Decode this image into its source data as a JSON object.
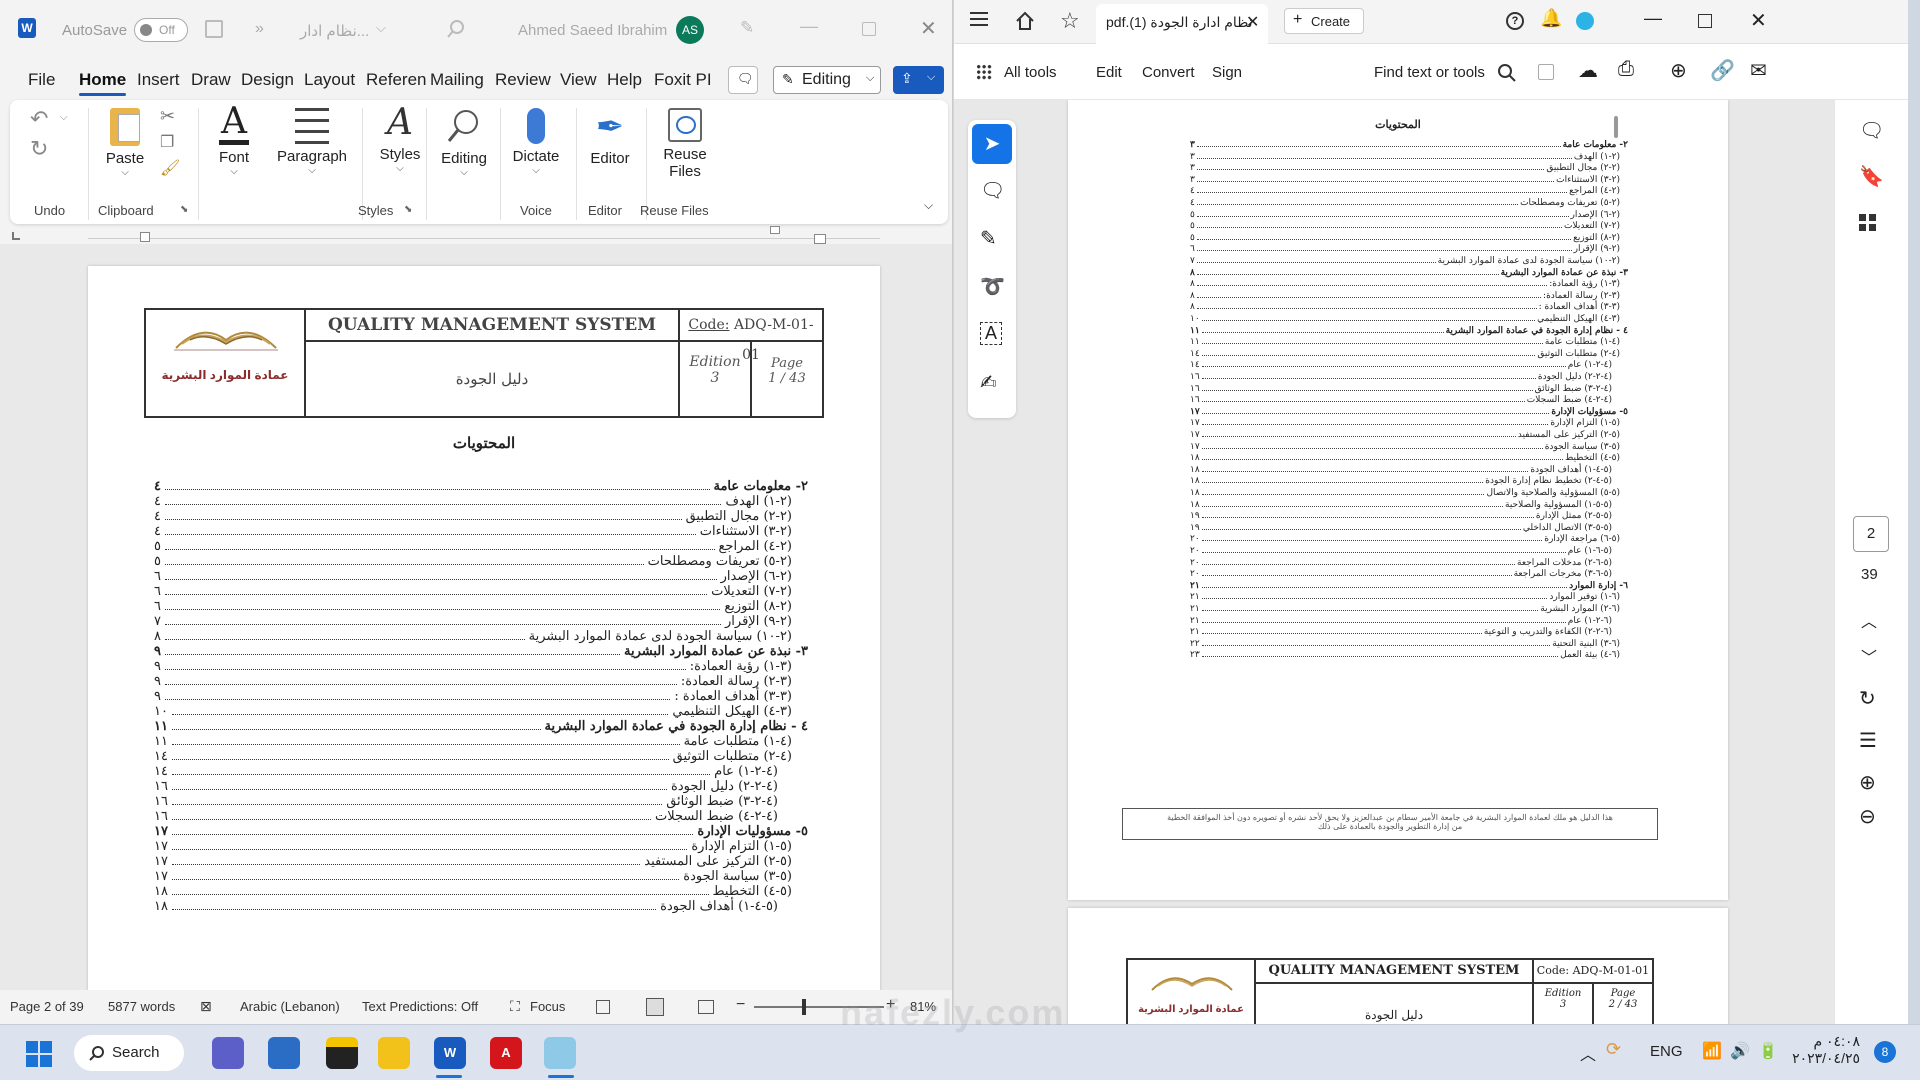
{
  "word": {
    "autosave_label": "AutoSave",
    "autosave_state": "Off",
    "doc_title": "نظام ادار...",
    "user_name": "Ahmed Saeed Ibrahim",
    "user_initials": "AS",
    "menu": [
      "File",
      "Home",
      "Insert",
      "Draw",
      "Design",
      "Layout",
      "Referen",
      "Mailing",
      "Review",
      "View",
      "Help",
      "Foxit PI"
    ],
    "editing_mode": "Editing",
    "ribbon": {
      "undo": "Undo",
      "paste": "Paste",
      "clipboard": "Clipboard",
      "font": "Font",
      "paragraph": "Paragraph",
      "styles": "Styles",
      "styles_group": "Styles",
      "editing": "Editing",
      "dictate": "Dictate",
      "voice": "Voice",
      "editor": "Editor",
      "editor_group": "Editor",
      "reuse_files_1": "Reuse",
      "reuse_files_2": "Files",
      "reuse_files_group": "Reuse Files"
    },
    "header": {
      "org": "عمادة الموارد البشرية",
      "system": "QUALITY MANAGEMENT SYSTEM",
      "code_label": "Code:",
      "code_value": "ADQ-M-01-01",
      "manual": "دليل الجودة",
      "edition_label": "Edition",
      "edition_value": "3",
      "page_label": "Page",
      "page_value": "1 / 43"
    },
    "toc_title": "المحتويات",
    "toc": [
      {
        "t": "٢- معلومات عامة",
        "p": "٤",
        "lvl": 0
      },
      {
        "t": "(٢-١) الهدف",
        "p": "٤",
        "lvl": 1
      },
      {
        "t": "(٢-٢) مجال التطبيق",
        "p": "٤",
        "lvl": 1
      },
      {
        "t": "(٢-٣) الاستثناءات",
        "p": "٤",
        "lvl": 1
      },
      {
        "t": "(٢-٤) المراجع",
        "p": "٥",
        "lvl": 1
      },
      {
        "t": "(٢-٥) تعريفات ومصطلحات",
        "p": "٥",
        "lvl": 1
      },
      {
        "t": "(٢-٦) الإصدار",
        "p": "٦",
        "lvl": 1
      },
      {
        "t": "(٢-٧) التعديلات",
        "p": "٦",
        "lvl": 1
      },
      {
        "t": "(٢-٨) التوزيع",
        "p": "٦",
        "lvl": 1
      },
      {
        "t": "(٢-٩) الإقرار",
        "p": "٧",
        "lvl": 1
      },
      {
        "t": "(٢-١٠) سياسة الجودة لدى عمادة الموارد البشرية",
        "p": "٨",
        "lvl": 1
      },
      {
        "t": "٣- نبذة عن عمادة الموارد البشرية",
        "p": "٩",
        "lvl": 0
      },
      {
        "t": "(٣-١) رؤية العمادة:",
        "p": "٩",
        "lvl": 1
      },
      {
        "t": "(٣-٢) رسالة العمادة:",
        "p": "٩",
        "lvl": 1
      },
      {
        "t": "(٣-٣) أهداف العمادة :",
        "p": "٩",
        "lvl": 1
      },
      {
        "t": "(٣-٤) الهيكل التنظيمي",
        "p": "١٠",
        "lvl": 1
      },
      {
        "t": "٤ - نظام إدارة الجودة في عمادة الموارد البشرية",
        "p": "١١",
        "lvl": 0
      },
      {
        "t": "(٤-١) متطلبات عامة",
        "p": "١١",
        "lvl": 1
      },
      {
        "t": "(٤-٢) متطلبات التوثيق",
        "p": "١٤",
        "lvl": 1
      },
      {
        "t": "(٤-٢-١) عام",
        "p": "١٤",
        "lvl": 2
      },
      {
        "t": "(٤-٢-٢) دليل الجودة",
        "p": "١٦",
        "lvl": 2
      },
      {
        "t": "(٤-٢-٣) ضبط الوثائق",
        "p": "١٦",
        "lvl": 2
      },
      {
        "t": "(٤-٢-٤) ضبط السجلات",
        "p": "١٦",
        "lvl": 2
      },
      {
        "t": "٥- مسؤوليات الإدارة",
        "p": "١٧",
        "lvl": 0
      },
      {
        "t": "(٥-١) التزام الإدارة",
        "p": "١٧",
        "lvl": 1
      },
      {
        "t": "(٥-٢) التركيز على المستفيد",
        "p": "١٧",
        "lvl": 1
      },
      {
        "t": "(٥-٣) سياسة الجودة",
        "p": "١٧",
        "lvl": 1
      },
      {
        "t": "(٥-٤) التخطيط",
        "p": "١٨",
        "lvl": 1
      },
      {
        "t": "(٥-٤-١) أهداف الجودة",
        "p": "١٨",
        "lvl": 2
      }
    ],
    "status": {
      "page": "Page 2 of 39",
      "words": "5877 words",
      "language": "Arabic (Lebanon)",
      "predictions": "Text Predictions: Off",
      "focus": "Focus",
      "zoom": "81%"
    }
  },
  "pdf": {
    "tab_title": "نظام ادارة الجودة (1).pdf",
    "create": "Create",
    "tools": [
      "All tools",
      "Edit",
      "Convert",
      "Sign"
    ],
    "find": "Find text or tools",
    "toc_title": "المحتويات",
    "toc": [
      {
        "t": "٢- معلومات عامة",
        "p": "٣",
        "lvl": 0
      },
      {
        "t": "(٢-١) الهدف",
        "p": "٣",
        "lvl": 1
      },
      {
        "t": "(٢-٢) مجال التطبيق",
        "p": "٣",
        "lvl": 1
      },
      {
        "t": "(٢-٣) الاستثناءات",
        "p": "٣",
        "lvl": 1
      },
      {
        "t": "(٢-٤) المراجع",
        "p": "٤",
        "lvl": 1
      },
      {
        "t": "(٢-٥) تعريفات ومصطلحات",
        "p": "٤",
        "lvl": 1
      },
      {
        "t": "(٢-٦) الإصدار",
        "p": "٥",
        "lvl": 1
      },
      {
        "t": "(٢-٧) التعديلات",
        "p": "٥",
        "lvl": 1
      },
      {
        "t": "(٢-٨) التوزيع",
        "p": "٥",
        "lvl": 1
      },
      {
        "t": "(٢-٩) الإقرار",
        "p": "٦",
        "lvl": 1
      },
      {
        "t": "(٢-١٠) سياسة الجودة لدى عمادة الموارد البشرية",
        "p": "٧",
        "lvl": 1
      },
      {
        "t": "٣- نبذة عن عمادة الموارد البشرية",
        "p": "٨",
        "lvl": 0
      },
      {
        "t": "(٣-١) رؤية العمادة:",
        "p": "٨",
        "lvl": 1
      },
      {
        "t": "(٣-٢) رسالة العمادة:",
        "p": "٨",
        "lvl": 1
      },
      {
        "t": "(٣-٣) أهداف العمادة :",
        "p": "٨",
        "lvl": 1
      },
      {
        "t": "(٣-٤) الهيكل التنظيمي",
        "p": "١٠",
        "lvl": 1
      },
      {
        "t": "٤ - نظام إدارة الجودة في عمادة الموارد البشرية",
        "p": "١١",
        "lvl": 0
      },
      {
        "t": "(٤-١) متطلبات عامة",
        "p": "١١",
        "lvl": 1
      },
      {
        "t": "(٤-٢) متطلبات التوثيق",
        "p": "١٤",
        "lvl": 1
      },
      {
        "t": "(٤-٢-١) عام",
        "p": "١٤",
        "lvl": 2
      },
      {
        "t": "(٤-٢-٢) دليل الجودة",
        "p": "١٦",
        "lvl": 2
      },
      {
        "t": "(٤-٢-٣) ضبط الوثائق",
        "p": "١٦",
        "lvl": 2
      },
      {
        "t": "(٤-٢-٤) ضبط السجلات",
        "p": "١٦",
        "lvl": 2
      },
      {
        "t": "٥- مسؤوليات الإدارة",
        "p": "١٧",
        "lvl": 0
      },
      {
        "t": "(٥-١) التزام الإدارة",
        "p": "١٧",
        "lvl": 1
      },
      {
        "t": "(٥-٢) التركيز على المستفيد",
        "p": "١٧",
        "lvl": 1
      },
      {
        "t": "(٥-٣) سياسة الجودة",
        "p": "١٧",
        "lvl": 1
      },
      {
        "t": "(٥-٤) التخطيط",
        "p": "١٨",
        "lvl": 1
      },
      {
        "t": "(٥-٤-١) أهداف الجودة",
        "p": "١٨",
        "lvl": 2
      },
      {
        "t": "(٥-٤-٢) تخطيط نظام إدارة الجودة",
        "p": "١٨",
        "lvl": 2
      },
      {
        "t": "(٥-٥) المسؤولية والصلاحية والاتصال",
        "p": "١٨",
        "lvl": 1
      },
      {
        "t": "(٥-٥-١) المسؤولية والصلاحية",
        "p": "١٨",
        "lvl": 2
      },
      {
        "t": "(٥-٥-٢) ممثل الإدارة",
        "p": "١٩",
        "lvl": 2
      },
      {
        "t": "(٥-٥-٣) الاتصال الداخلي",
        "p": "١٩",
        "lvl": 2
      },
      {
        "t": "(٥-٦) مراجعة الإدارة",
        "p": "٢٠",
        "lvl": 1
      },
      {
        "t": "(٥-٦-١) عام",
        "p": "٢٠",
        "lvl": 2
      },
      {
        "t": "(٥-٦-٢) مدخلات المراجعة",
        "p": "٢٠",
        "lvl": 2
      },
      {
        "t": "(٥-٦-٣) مخرجات المراجعة",
        "p": "٢٠",
        "lvl": 2
      },
      {
        "t": "٦- إدارة الموارد",
        "p": "٢١",
        "lvl": 0
      },
      {
        "t": "(٦-١) توفير الموارد",
        "p": "٢١",
        "lvl": 1
      },
      {
        "t": "(٦-٢) الموارد البشرية",
        "p": "٢١",
        "lvl": 1
      },
      {
        "t": "(٦-٢-١) عام",
        "p": "٢١",
        "lvl": 2
      },
      {
        "t": "(٦-٢-٢) الكفاءة والتدريب و التوعية",
        "p": "٢١",
        "lvl": 2
      },
      {
        "t": "(٦-٣) البنية التحتية",
        "p": "٢٢",
        "lvl": 1
      },
      {
        "t": "(٦-٤) بيئة العمل",
        "p": "٢٣",
        "lvl": 1
      }
    ],
    "footer_note_1": "هذا الدليل هو ملك لعمادة الموارد البشرية في جامعة الأمير سطام بن عبدالعزيز ولا يحق لأحد نشره أو تصويره دون أخذ الموافقة الخطية",
    "footer_note_2": "من إدارة التطوير والجودة بالعمادة على ذلك",
    "page2_header": {
      "system": "QUALITY MANAGEMENT SYSTEM",
      "code": "Code: ADQ-M-01-01",
      "manual": "دليل الجودة",
      "org": "عمادة الموارد البشرية",
      "edition_label": "Edition",
      "edition_value": "3",
      "page_label": "Page",
      "page_value": "2 / 43"
    },
    "current_page": "2",
    "total_pages": "39"
  },
  "taskbar": {
    "search": "Search",
    "lang": "ENG",
    "time": "٠٤:٠٨ م",
    "date": "٢٠٢٣/٠٤/٢٥",
    "notif": "8"
  },
  "watermark": "nafezly.com",
  "colors": {
    "accent": "#185abd",
    "word_blue": "#185abd",
    "acrobat_red": "#d4161c"
  }
}
